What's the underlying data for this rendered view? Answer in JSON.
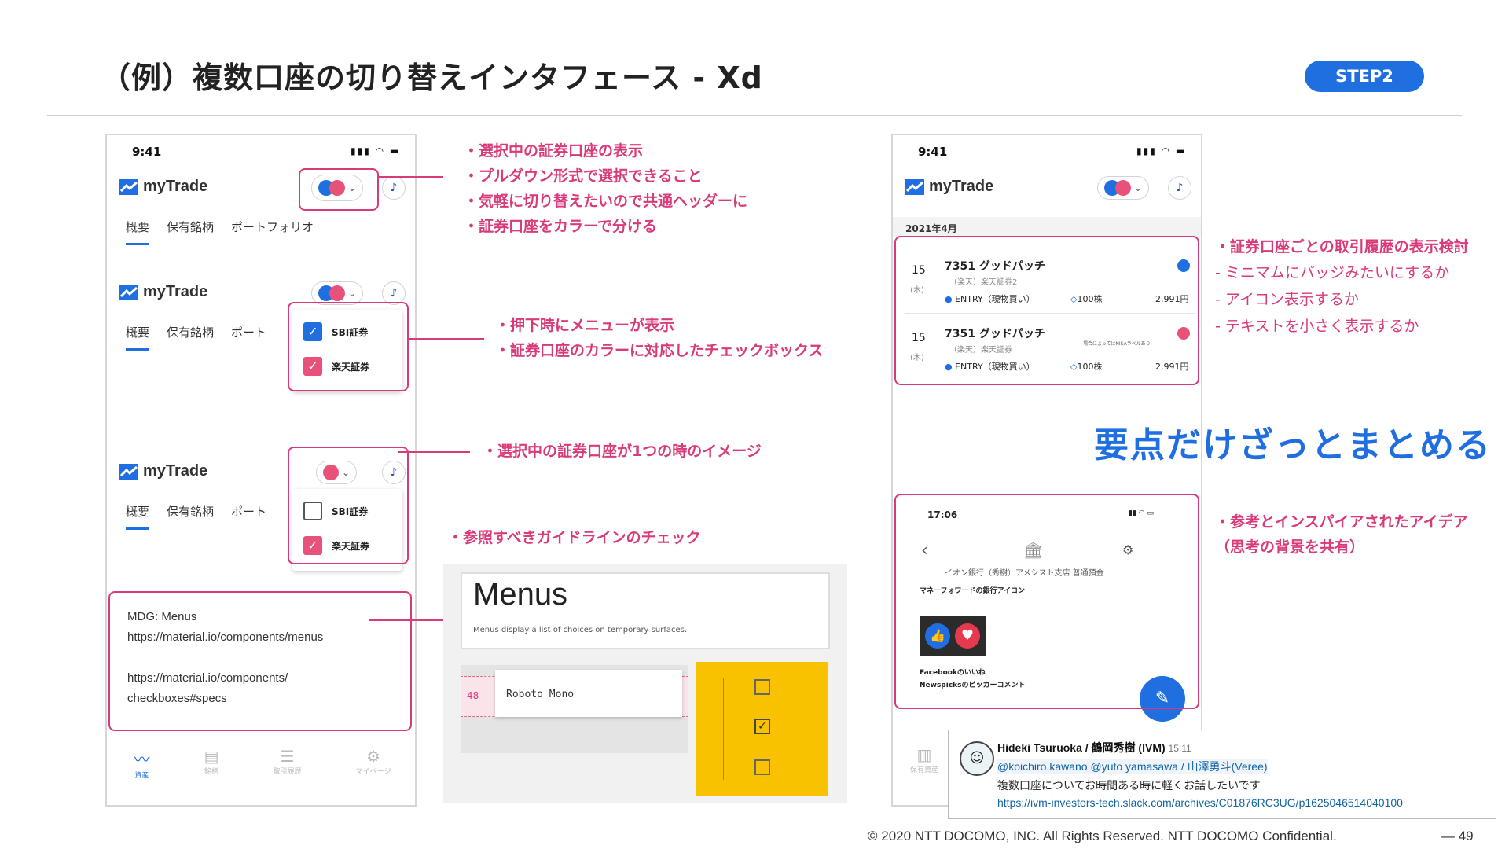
{
  "header": {
    "title": "（例）複数口座の切り替えインタフェース - Xd",
    "step_badge": "STEP2"
  },
  "phone_left": {
    "time": "9:41",
    "app_name": "myTrade",
    "tabs": [
      "概要",
      "保有銘柄",
      "ポートフォリオ"
    ],
    "tabs_cut": [
      "概要",
      "保有銘柄",
      "ポート"
    ],
    "menu_items": [
      {
        "label": "SBI証券",
        "state": "checked",
        "color": "#1f6fe0"
      },
      {
        "label": "楽天証券",
        "state": "checked",
        "color": "#e8527a"
      }
    ],
    "menu_items_single": [
      {
        "label": "SBI証券",
        "state": "unchecked"
      },
      {
        "label": "楽天証券",
        "state": "checked",
        "color": "#e8527a"
      }
    ],
    "links": {
      "title": "MDG: Menus",
      "url1": "https://material.io/components/menus",
      "url2a": "https://material.io/components/",
      "url2b": "checkboxes#specs"
    },
    "bottom_nav": [
      "資産",
      "銘柄",
      "取引履歴",
      "マイページ"
    ]
  },
  "notes_left": {
    "group1": [
      "・選択中の証券口座の表示",
      "・プルダウン形式で選択できること",
      "・気軽に切り替えたいので共通ヘッダーに",
      "・証券口座をカラーで分ける"
    ],
    "group2": [
      "・押下時にメニューが表示",
      "・証券口座のカラーに対応したチェックボックス"
    ],
    "group3": [
      "・選択中の証券口座が1つの時のイメージ"
    ],
    "group4": [
      "・参照すべきガイドラインのチェック"
    ]
  },
  "guideline": {
    "heading": "Menus",
    "desc": "Menus display a list of choices on temporary surfaces.",
    "spec_num": "48",
    "font_sample": "Roboto Mono"
  },
  "phone_right": {
    "time": "9:41",
    "app_name": "myTrade",
    "month": "2021年4月",
    "trades": [
      {
        "day": "15",
        "weekday": "(木)",
        "name": "7351 グッドパッチ",
        "sub": "（楽天）楽天証券2",
        "type": "ENTRY（現物買い）",
        "qty": "100株",
        "price": "2,991円",
        "note": ""
      },
      {
        "day": "15",
        "weekday": "(木)",
        "name": "7351 グッドパッチ",
        "sub": "（楽天）楽天証券",
        "type": "ENTRY（現物買い）",
        "qty": "100株",
        "price": "2,991円",
        "note": "場合によってはNISAラベルあり"
      }
    ],
    "inspo": {
      "time": "17:06",
      "bank": "イオン銀行（秀樹）アメシスト支店 普通預金",
      "caption1": "マネーフォワードの銀行アイコン",
      "caption2": "Facebookのいいね",
      "caption3": "Newspicksのピッカーコメント"
    },
    "nav_first": "保有資産"
  },
  "notes_right": {
    "group1_title": "・証券口座ごとの取引履歴の表示検討",
    "group1_items": [
      "- ミニマムにバッジみたいにするか",
      "- アイコン表示するか",
      "- テキストを小さく表示するか"
    ],
    "group2": [
      "・参考とインスパイアされたアイデア",
      "（思考の背景を共有）"
    ]
  },
  "headline": "要点だけざっとまとめる",
  "slack": {
    "author": "Hideki Tsuruoka / 鶴岡秀樹 (IVM)",
    "time": "15:11",
    "mentions": "@koichiro.kawano @yuto yamasawa / 山澤勇斗(Veree)",
    "message": "複数口座についてお時間ある時に軽くお話したいです",
    "link": "https://ivm-investors-tech.slack.com/archives/C01876RC3UG/p1625046514040100"
  },
  "footer": {
    "copyright": "© 2020 NTT DOCOMO, INC. All Rights Reserved. NTT DOCOMO Confidential.",
    "page": "—  49"
  },
  "colors": {
    "accent_blue": "#1f6fe0",
    "accent_pink": "#d93a7a",
    "guideline_yellow": "#f9c200"
  }
}
